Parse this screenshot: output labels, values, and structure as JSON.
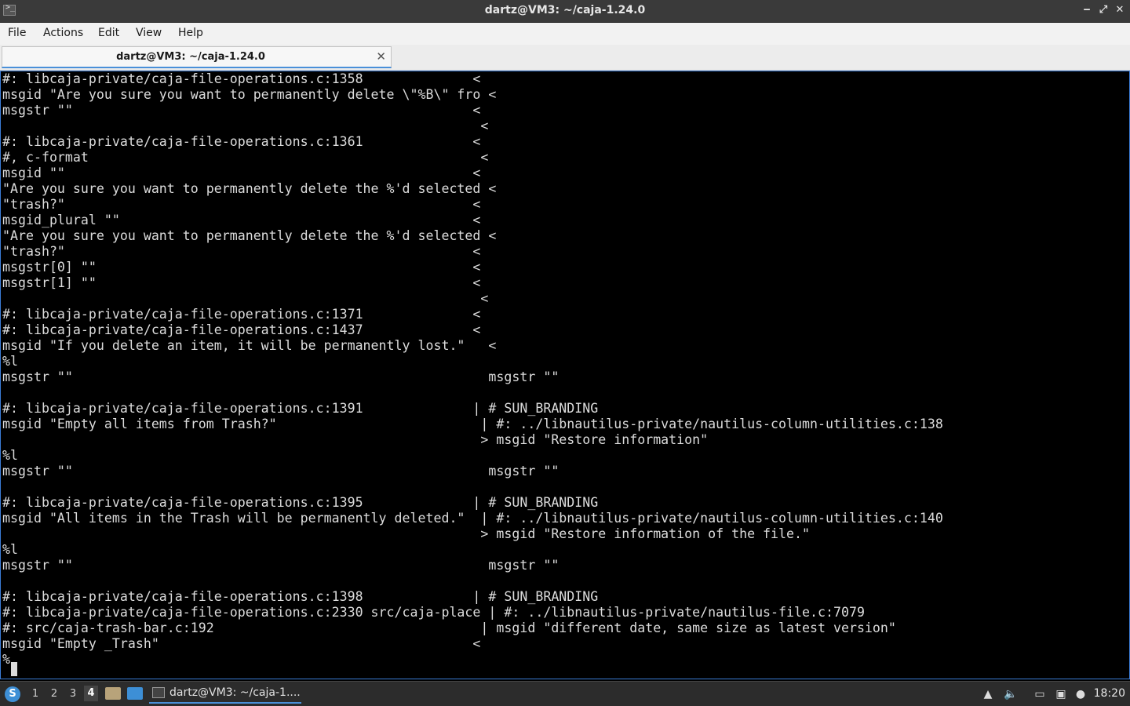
{
  "window": {
    "title": "dartz@VM3: ~/caja-1.24.0",
    "icon": "terminal-icon",
    "buttons": {
      "minimize": "‒",
      "maximize": "⤢",
      "close": "✕"
    }
  },
  "menu": [
    "File",
    "Actions",
    "Edit",
    "View",
    "Help"
  ],
  "tab": {
    "label": "dartz@VM3: ~/caja-1.24.0",
    "close": "✕"
  },
  "terminal": {
    "lines": [
      "#: libcaja-private/caja-file-operations.c:1358              <",
      "msgid \"Are you sure you want to permanently delete \\\"%B\\\" fro <",
      "msgstr \"\"                                                   <",
      "                                                             <",
      "#: libcaja-private/caja-file-operations.c:1361              <",
      "#, c-format                                                  <",
      "msgid \"\"                                                    <",
      "\"Are you sure you want to permanently delete the %'d selected <",
      "\"trash?\"                                                    <",
      "msgid_plural \"\"                                             <",
      "\"Are you sure you want to permanently delete the %'d selected <",
      "\"trash?\"                                                    <",
      "msgstr[0] \"\"                                                <",
      "msgstr[1] \"\"                                                <",
      "                                                             <",
      "#: libcaja-private/caja-file-operations.c:1371              <",
      "#: libcaja-private/caja-file-operations.c:1437              <",
      "msgid \"If you delete an item, it will be permanently lost.\"   <",
      "%l",
      "msgstr \"\"                                                     msgstr \"\"",
      "",
      "#: libcaja-private/caja-file-operations.c:1391              | # SUN_BRANDING",
      "msgid \"Empty all items from Trash?\"                          | #: ../libnautilus-private/nautilus-column-utilities.c:138",
      "                                                             > msgid \"Restore information\"",
      "%l",
      "msgstr \"\"                                                     msgstr \"\"",
      "",
      "#: libcaja-private/caja-file-operations.c:1395              | # SUN_BRANDING",
      "msgid \"All items in the Trash will be permanently deleted.\"  | #: ../libnautilus-private/nautilus-column-utilities.c:140",
      "                                                             > msgid \"Restore information of the file.\"",
      "%l",
      "msgstr \"\"                                                     msgstr \"\"",
      "",
      "#: libcaja-private/caja-file-operations.c:1398              | # SUN_BRANDING",
      "#: libcaja-private/caja-file-operations.c:2330 src/caja-place | #: ../libnautilus-private/nautilus-file.c:7079",
      "#: src/caja-trash-bar.c:192                                  | msgid \"different date, same size as latest version\"",
      "msgid \"Empty _Trash\"                                        <",
      "%"
    ]
  },
  "taskbar": {
    "workspaces": [
      "1",
      "2",
      "3",
      "4"
    ],
    "active_workspace": "4",
    "task_label": "dartz@VM3: ~/caja-1....",
    "clock": "18:20"
  }
}
